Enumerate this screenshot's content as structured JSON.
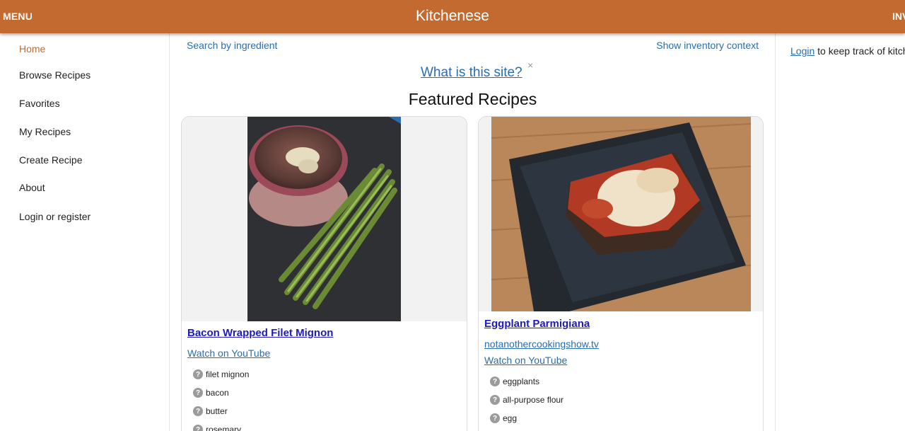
{
  "header": {
    "menu_label": "MENU",
    "brand": "Kitchenese",
    "inventory_label": "INV"
  },
  "nav": {
    "items": [
      {
        "label": "Home",
        "active": true
      },
      {
        "label": "Browse Recipes"
      },
      {
        "label": "Favorites"
      },
      {
        "label": "My Recipes"
      },
      {
        "label": "Create Recipe"
      },
      {
        "label": "About"
      },
      {
        "label": "Login or register"
      }
    ]
  },
  "main": {
    "search_link": "Search by ingredient",
    "inventory_context_link": "Show inventory context",
    "what_link": "What is this site?",
    "close_symbol": "×",
    "featured_heading": "Featured Recipes"
  },
  "sidebar_right": {
    "login_link": "Login",
    "message": " to keep track of kitche"
  },
  "recipes": [
    {
      "title": "Bacon Wrapped Filet Mignon",
      "links": [
        "Watch on YouTube"
      ],
      "ingredients": [
        "filet mignon",
        "bacon",
        "butter",
        "rosemary"
      ],
      "question_symbol": "?"
    },
    {
      "title": "Eggplant Parmigiana",
      "links": [
        "notanothercookingshow.tv",
        "Watch on YouTube"
      ],
      "ingredients": [
        "eggplants",
        "all-purpose flour",
        "egg"
      ],
      "question_symbol": "?"
    }
  ],
  "colors": {
    "brand": "#c26a2f",
    "link": "#2a6db0",
    "title_link": "#1b1bbf"
  }
}
